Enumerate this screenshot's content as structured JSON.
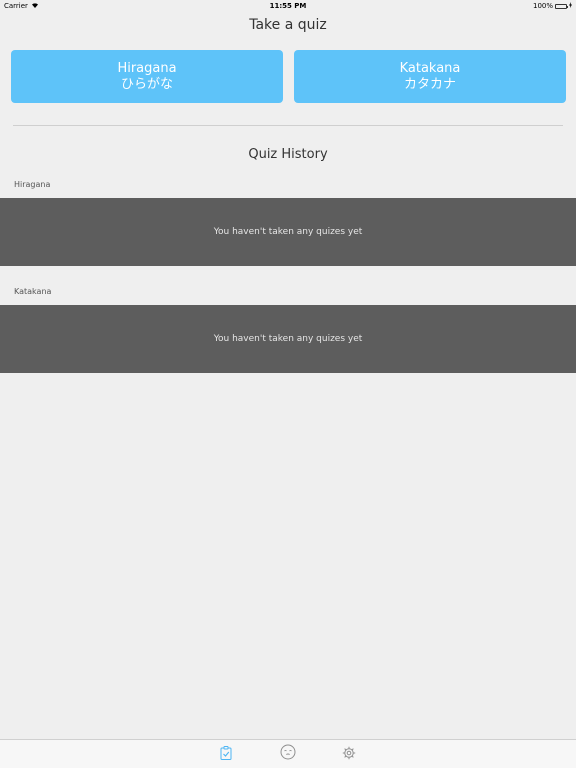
{
  "status_bar": {
    "carrier": "Carrier",
    "time": "11:55 PM",
    "battery": "100%",
    "battery_level": 1.0
  },
  "quiz": {
    "title": "Take a quiz",
    "buttons": [
      {
        "label": "Hiragana",
        "sub": "ひらがな"
      },
      {
        "label": "Katakana",
        "sub": "カタカナ"
      }
    ]
  },
  "history": {
    "title": "Quiz History",
    "sections": [
      {
        "label": "Hiragana",
        "message": "You haven't taken any quizes yet"
      },
      {
        "label": "Katakana",
        "message": "You haven't taken any quizes yet"
      }
    ]
  },
  "tab_bar": {
    "tabs": [
      {
        "icon": "quiz-clipboard-icon",
        "active": true
      },
      {
        "icon": "face-icon",
        "active": false
      },
      {
        "icon": "gear-icon",
        "active": false
      }
    ],
    "colors": {
      "active": "#4db5f3",
      "inactive": "#8e8e8e"
    }
  },
  "colors": {
    "button": "#5ec3f9",
    "panel": "#5d5d5d",
    "background": "#efefef"
  }
}
